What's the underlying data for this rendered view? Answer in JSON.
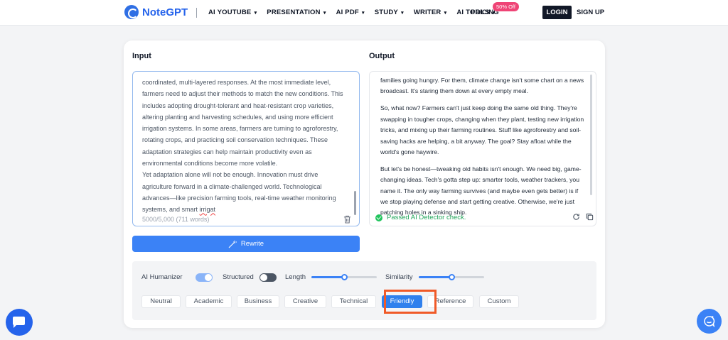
{
  "brand": {
    "name": "NoteGPT"
  },
  "nav": {
    "items": [
      {
        "label": "AI YOUTUBE"
      },
      {
        "label": "PRESENTATION"
      },
      {
        "label": "AI PDF"
      },
      {
        "label": "STUDY"
      },
      {
        "label": "WRITER"
      },
      {
        "label": "AI TOOLS"
      }
    ],
    "pricing": "PRICING",
    "pricing_badge": "50% Off",
    "login": "LOGIN",
    "signup": "SIGN UP"
  },
  "input": {
    "label": "Input",
    "lines": [
      "coordinated, multi-layered responses. At the most immediate level,",
      "farmers need to adjust their methods to match the new conditions. This",
      "includes adopting drought-tolerant and heat-resistant crop varieties,",
      "altering planting and harvesting schedules, and using more efficient",
      "irrigation systems. In some areas, farmers are turning to agroforestry,",
      "rotating crops, and practicing soil conservation techniques. These",
      "adaptation strategies can help maintain productivity even as",
      "environmental conditions become more volatile.",
      "Yet adaptation alone will not be enough. Innovation must drive",
      "agriculture forward in a climate-challenged world. Technological",
      "advances—like precision farming tools, real-time weather monitoring"
    ],
    "last_line_prefix": "systems, and smart ",
    "last_line_misspelled": "irrigat",
    "char_count": "5000/5,000 (711 words)"
  },
  "rewrite_button": "Rewrite",
  "output": {
    "label": "Output",
    "paragraphs": [
      "families going hungry. For them, climate change isn't some chart on a news broadcast. It's staring them down at every empty meal.",
      "So, what now? Farmers can't just keep doing the same old thing. They're swapping in tougher crops, changing when they plant, testing new irrigation tricks, and mixing up their farming routines. Stuff like agroforestry and soil-saving hacks are helping, a bit anyway. The goal? Stay afloat while the world's gone haywire.",
      "But let's be honest—tweaking old habits isn't enough. We need big, game-changing ideas. Tech's gotta step up: smarter tools, weather trackers, you name it. The only way farming survives (and maybe even gets better) is if we stop playing defense and start getting creative. Otherwise, we're just patching holes in a sinking ship."
    ],
    "detector_status": "Passed AI Detector check."
  },
  "settings": {
    "humanizer_label": "AI Humanizer",
    "humanizer_on": true,
    "structured_label": "Structured",
    "structured_on": false,
    "length_label": "Length",
    "length_value": 0.5,
    "similarity_label": "Similarity",
    "similarity_value": 0.5,
    "tones": [
      "Neutral",
      "Academic",
      "Business",
      "Creative",
      "Technical",
      "Friendly",
      "Reference",
      "Custom"
    ],
    "selected_tone": "Friendly"
  },
  "colors": {
    "accent": "#3b82f6",
    "brand": "#2563eb",
    "success": "#22a55b",
    "highlight": "#f05a28",
    "badge": "#ef4476"
  }
}
